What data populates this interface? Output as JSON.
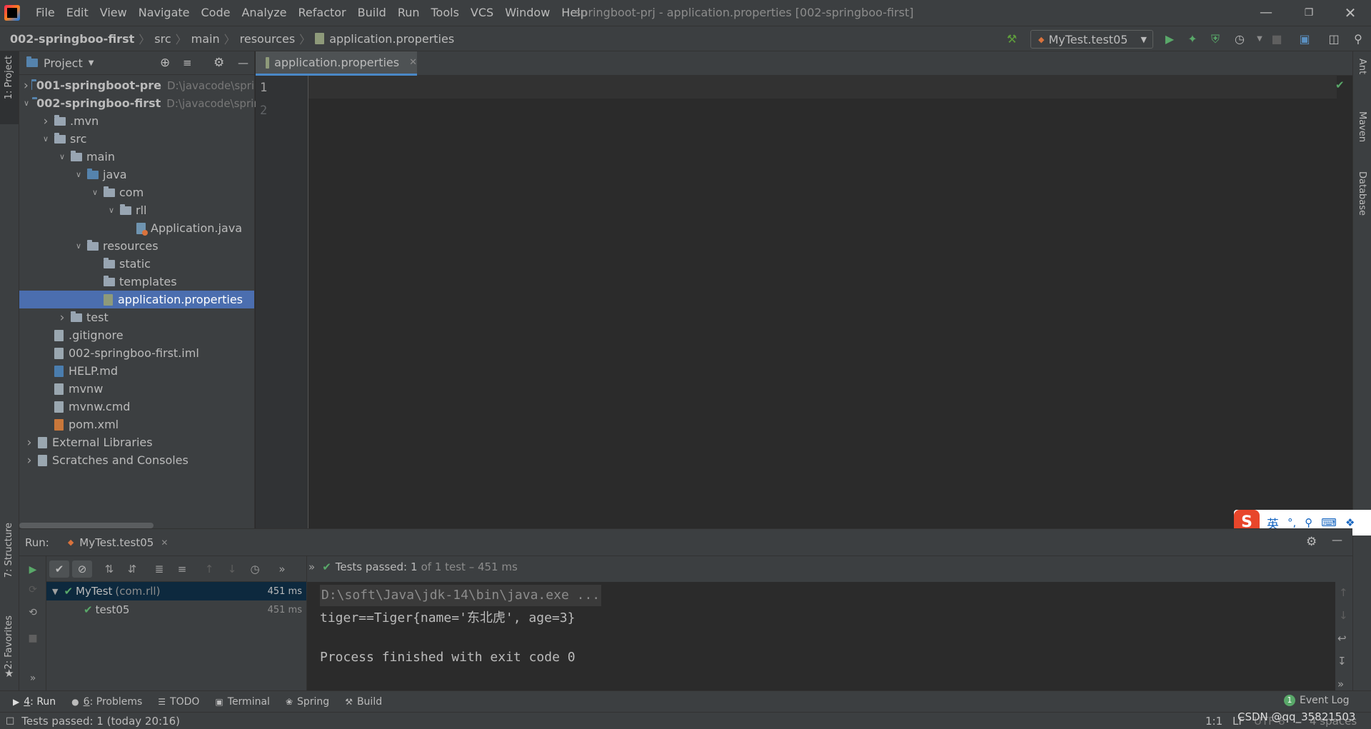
{
  "menubar": {
    "items": [
      "File",
      "Edit",
      "View",
      "Navigate",
      "Code",
      "Analyze",
      "Refactor",
      "Build",
      "Run",
      "Tools",
      "VCS",
      "Window",
      "Help"
    ],
    "window_title": "springboot-prj - application.properties [002-springboo-first]"
  },
  "navbar": {
    "breadcrumbs": [
      "002-springboo-first",
      "src",
      "main",
      "resources",
      "application.properties"
    ],
    "run_config": "MyTest.test05"
  },
  "left_strip": {
    "project_tab": "1: Project",
    "structure_tab": "7: Structure",
    "favorites_tab": "2: Favorites"
  },
  "right_strip": {
    "ant_tab": "Ant",
    "maven_tab": "Maven",
    "database_tab": "Database"
  },
  "project": {
    "title": "Project",
    "tree": [
      {
        "label": "001-springboot-pre",
        "hint": "D:\\javacode\\spri",
        "depth": 0,
        "arrow": "right",
        "icon": "module",
        "bold": true
      },
      {
        "label": "002-springboo-first",
        "hint": "D:\\javacode\\sprin",
        "depth": 0,
        "arrow": "down",
        "icon": "module",
        "bold": true
      },
      {
        "label": ".mvn",
        "depth": 1,
        "arrow": "right",
        "icon": "folder"
      },
      {
        "label": "src",
        "depth": 1,
        "arrow": "down",
        "icon": "folder"
      },
      {
        "label": "main",
        "depth": 2,
        "arrow": "down",
        "icon": "folder"
      },
      {
        "label": "java",
        "depth": 3,
        "arrow": "down",
        "icon": "folder-src"
      },
      {
        "label": "com",
        "depth": 4,
        "arrow": "down",
        "icon": "folder"
      },
      {
        "label": "rll",
        "depth": 5,
        "arrow": "down",
        "icon": "folder"
      },
      {
        "label": "Application.java",
        "depth": 6,
        "arrow": "",
        "icon": "java"
      },
      {
        "label": "resources",
        "depth": 3,
        "arrow": "down",
        "icon": "folder"
      },
      {
        "label": "static",
        "depth": 4,
        "arrow": "",
        "icon": "folder"
      },
      {
        "label": "templates",
        "depth": 4,
        "arrow": "",
        "icon": "folder"
      },
      {
        "label": "application.properties",
        "depth": 4,
        "arrow": "",
        "icon": "props",
        "selected": true
      },
      {
        "label": "test",
        "depth": 2,
        "arrow": "right",
        "icon": "folder"
      },
      {
        "label": ".gitignore",
        "depth": 1,
        "arrow": "",
        "icon": "file"
      },
      {
        "label": "002-springboo-first.iml",
        "depth": 1,
        "arrow": "",
        "icon": "file"
      },
      {
        "label": "HELP.md",
        "depth": 1,
        "arrow": "",
        "icon": "md"
      },
      {
        "label": "mvnw",
        "depth": 1,
        "arrow": "",
        "icon": "file"
      },
      {
        "label": "mvnw.cmd",
        "depth": 1,
        "arrow": "",
        "icon": "file"
      },
      {
        "label": "pom.xml",
        "depth": 1,
        "arrow": "",
        "icon": "xml"
      },
      {
        "label": "External Libraries",
        "depth": 0,
        "arrow": "right",
        "icon": "libs"
      },
      {
        "label": "Scratches and Consoles",
        "depth": 0,
        "arrow": "right",
        "icon": "scratch"
      }
    ]
  },
  "editor": {
    "tab_label": "application.properties",
    "line_numbers": [
      "1",
      "2"
    ]
  },
  "run": {
    "label": "Run:",
    "tab_label": "MyTest.test05",
    "tests_passed_label": "Tests passed:",
    "tests_passed_count": "1",
    "tests_passed_detail": "of 1 test – 451 ms",
    "tree": [
      {
        "label": "MyTest",
        "pkg": "(com.rll)",
        "time": "451 ms"
      },
      {
        "label": "test05",
        "pkg": "",
        "time": "451 ms"
      }
    ],
    "console": [
      "D:\\soft\\Java\\jdk-14\\bin\\java.exe ...",
      "tiger==Tiger{name='东北虎', age=3}",
      "",
      "Process finished with exit code 0"
    ]
  },
  "bottom_tabs": [
    {
      "num": "4",
      "label": ": Run",
      "icon": "run-icon"
    },
    {
      "num": "6",
      "label": ": Problems",
      "icon": "problems-icon"
    },
    {
      "num": "",
      "label": "TODO",
      "icon": "todo-icon"
    },
    {
      "num": "",
      "label": "Terminal",
      "icon": "terminal-icon"
    },
    {
      "num": "",
      "label": "Spring",
      "icon": "spring-icon"
    },
    {
      "num": "",
      "label": "Build",
      "icon": "build-icon"
    }
  ],
  "event_log": {
    "count": "1",
    "label": "Event Log"
  },
  "status": {
    "message": "Tests passed: 1 (today 20:16)",
    "position": "1:1",
    "line_sep": "LF",
    "encoding": "UTF-8",
    "indent": "4 spaces",
    "watermark": "CSDN @qq_35821503"
  },
  "ime": {
    "lang": "英"
  }
}
